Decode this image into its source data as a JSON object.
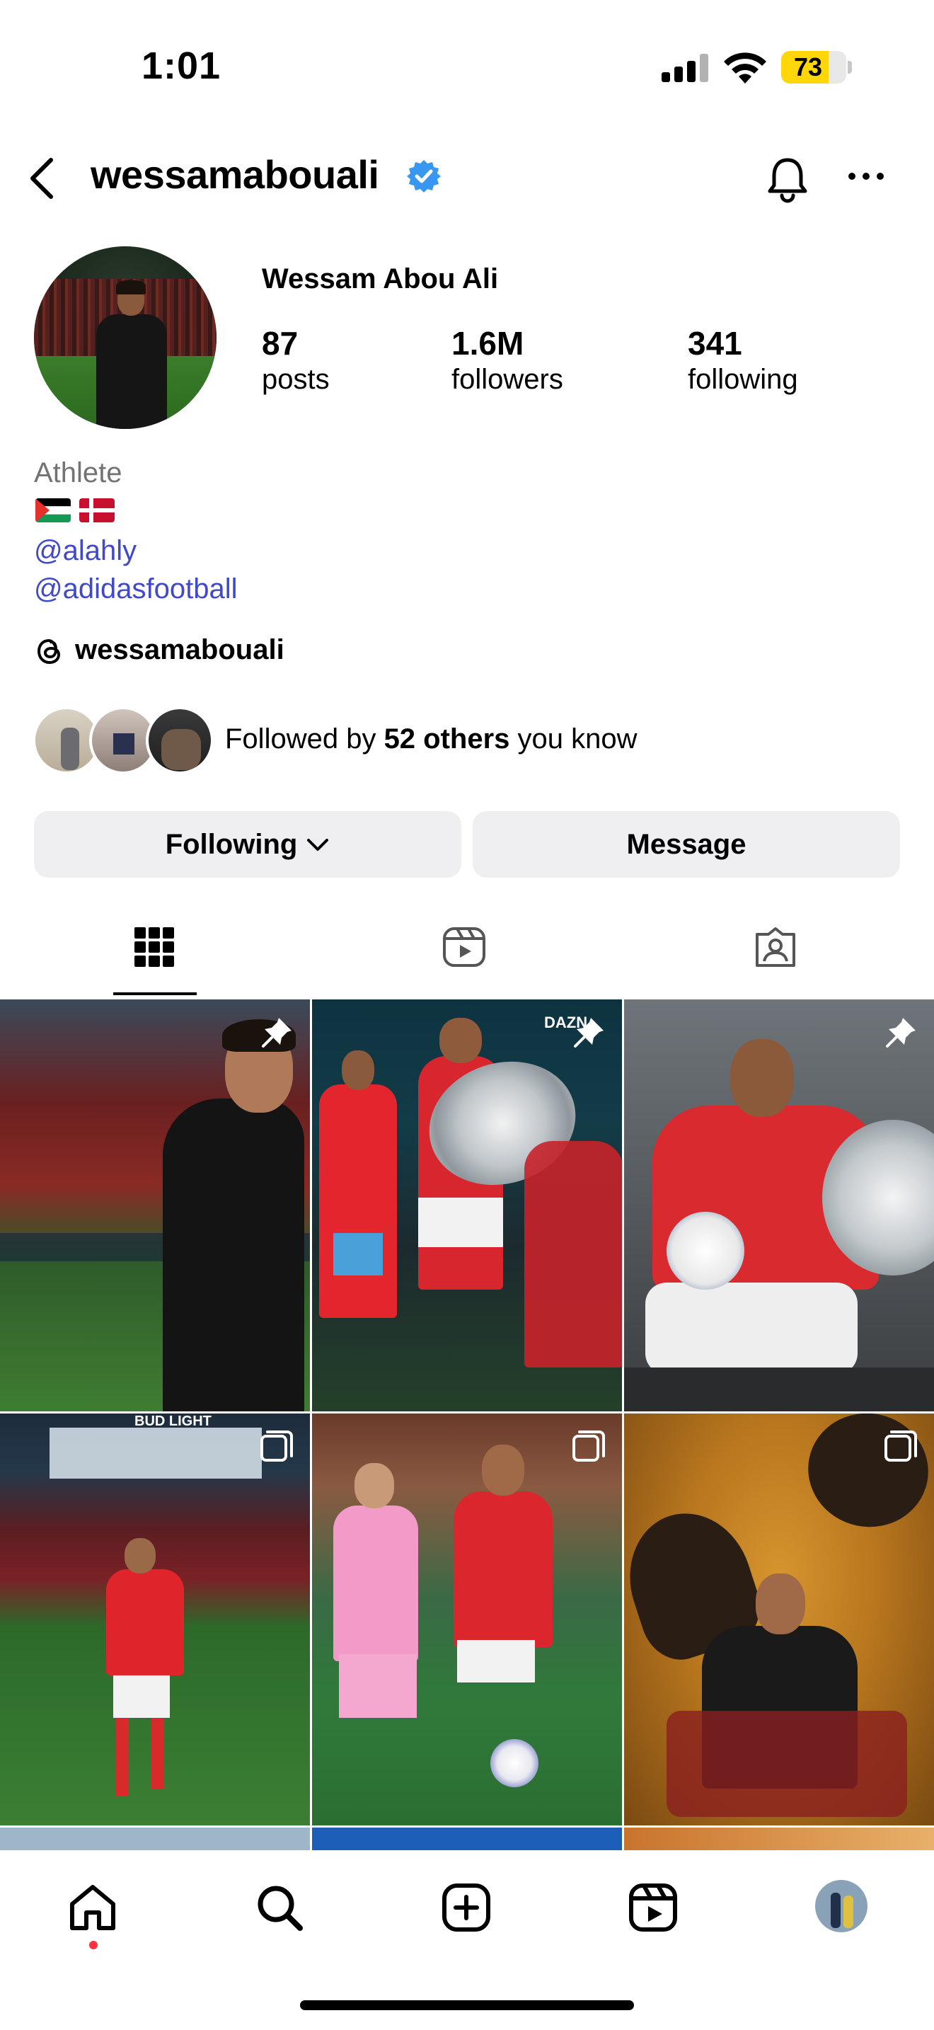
{
  "status_bar": {
    "time": "1:01",
    "battery_level": "73"
  },
  "header": {
    "username": "wessamabouali"
  },
  "profile": {
    "full_name": "Wessam Abou Ali",
    "stats": [
      {
        "value": "87",
        "label": "posts"
      },
      {
        "value": "1.6M",
        "label": "followers"
      },
      {
        "value": "341",
        "label": "following"
      }
    ],
    "category": "Athlete",
    "links": [
      "@alahly",
      "@adidasfootball"
    ],
    "threads_handle": "wessamabouali",
    "followed_by": {
      "prefix": "Followed by ",
      "count_text": "52 others",
      "suffix": " you know"
    }
  },
  "actions": {
    "following_label": "Following",
    "message_label": "Message"
  },
  "tabs": [
    {
      "icon": "grid-icon",
      "active": true
    },
    {
      "icon": "reels-icon",
      "active": false
    },
    {
      "icon": "tagged-icon",
      "active": false
    }
  ],
  "posts": [
    {
      "badge": "pin-icon"
    },
    {
      "badge": "pin-icon",
      "overlay_text": "DAZN"
    },
    {
      "badge": "pin-icon"
    },
    {
      "badge": "carousel-icon",
      "overlay_text": "BUD LIGHT"
    },
    {
      "badge": "carousel-icon"
    },
    {
      "badge": "carousel-icon"
    }
  ],
  "bottom_nav": [
    "home-icon",
    "search-icon",
    "create-icon",
    "reels-icon",
    "profile-avatar"
  ],
  "colors": {
    "link": "#4049c9",
    "verified": "#3897f0",
    "battery": "#ffd60a",
    "button_bg": "#efeff1",
    "notification_dot": "#ff3040"
  }
}
